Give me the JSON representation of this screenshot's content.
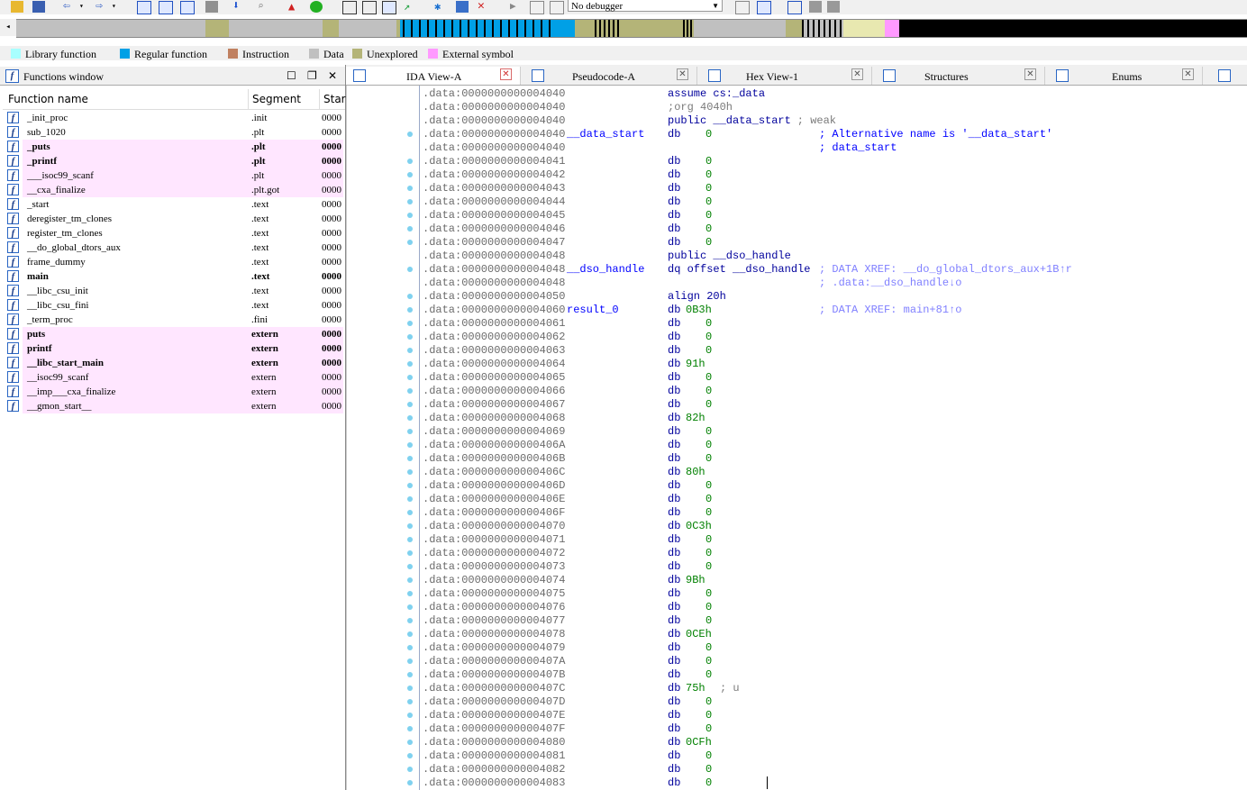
{
  "toolbar": {
    "debugger_label": "No debugger",
    "icons": [
      "open-icon",
      "save-icon",
      "back-icon",
      "forward-icon",
      "toggle-icon",
      "tools-icon",
      "down-arrow-icon",
      "search-icon",
      "warning-icon",
      "green-circle-icon",
      "code-icon",
      "data-icon",
      "string-icon",
      "arrow-icon",
      "breakpoint-icon",
      "camera-icon",
      "stop-icon",
      "play-icon",
      "pause-icon",
      "stop-square-icon",
      "attach-icon",
      "debug-icon"
    ]
  },
  "colors": {
    "library_function": "#a8ffff",
    "regular_function": "#00a0e6",
    "instruction": "#c08060",
    "data": "#c0c0c0",
    "unexplored": "#b4b478",
    "external_symbol": "#ff99ff",
    "pink_row": "#ffe6ff"
  },
  "legend": [
    "Library function",
    "Regular function",
    "Instruction",
    "Data",
    "Unexplored",
    "External symbol"
  ],
  "functions_window": {
    "title": "Functions window",
    "columns": [
      "Function name",
      "Segment",
      "Star"
    ],
    "rows": [
      {
        "name": "_init_proc",
        "segment": ".init",
        "start": "0000",
        "pink": false,
        "bold": false
      },
      {
        "name": "sub_1020",
        "segment": ".plt",
        "start": "0000",
        "pink": false,
        "bold": false
      },
      {
        "name": "_puts",
        "segment": ".plt",
        "start": "0000",
        "pink": true,
        "bold": true
      },
      {
        "name": "_printf",
        "segment": ".plt",
        "start": "0000",
        "pink": true,
        "bold": true
      },
      {
        "name": "___isoc99_scanf",
        "segment": ".plt",
        "start": "0000",
        "pink": true,
        "bold": false
      },
      {
        "name": "__cxa_finalize",
        "segment": ".plt.got",
        "start": "0000",
        "pink": true,
        "bold": false
      },
      {
        "name": "_start",
        "segment": ".text",
        "start": "0000",
        "pink": false,
        "bold": false
      },
      {
        "name": "deregister_tm_clones",
        "segment": ".text",
        "start": "0000",
        "pink": false,
        "bold": false
      },
      {
        "name": "register_tm_clones",
        "segment": ".text",
        "start": "0000",
        "pink": false,
        "bold": false
      },
      {
        "name": "__do_global_dtors_aux",
        "segment": ".text",
        "start": "0000",
        "pink": false,
        "bold": false
      },
      {
        "name": "frame_dummy",
        "segment": ".text",
        "start": "0000",
        "pink": false,
        "bold": false
      },
      {
        "name": "main",
        "segment": ".text",
        "start": "0000",
        "pink": false,
        "bold": true
      },
      {
        "name": "__libc_csu_init",
        "segment": ".text",
        "start": "0000",
        "pink": false,
        "bold": false
      },
      {
        "name": "__libc_csu_fini",
        "segment": ".text",
        "start": "0000",
        "pink": false,
        "bold": false
      },
      {
        "name": "_term_proc",
        "segment": ".fini",
        "start": "0000",
        "pink": false,
        "bold": false
      },
      {
        "name": "puts",
        "segment": "extern",
        "start": "0000",
        "pink": true,
        "bold": true
      },
      {
        "name": "printf",
        "segment": "extern",
        "start": "0000",
        "pink": true,
        "bold": true
      },
      {
        "name": "__libc_start_main",
        "segment": "extern",
        "start": "0000",
        "pink": true,
        "bold": true
      },
      {
        "name": "__isoc99_scanf",
        "segment": "extern",
        "start": "0000",
        "pink": true,
        "bold": false
      },
      {
        "name": "__imp___cxa_finalize",
        "segment": "extern",
        "start": "0000",
        "pink": true,
        "bold": false
      },
      {
        "name": "__gmon_start__",
        "segment": "extern",
        "start": "0000",
        "pink": true,
        "bold": false
      }
    ]
  },
  "tabs": [
    {
      "label": "IDA View-A",
      "active": true
    },
    {
      "label": "Pseudocode-A",
      "active": false
    },
    {
      "label": "Hex View-1",
      "active": false
    },
    {
      "label": "Structures",
      "active": false
    },
    {
      "label": "Enums",
      "active": false
    }
  ],
  "disasm": [
    {
      "addr": ".data:0000000000004040",
      "dot": false,
      "label": "",
      "mnem": "assume cs:_data",
      "operand": "",
      "comment": "",
      "xref": ""
    },
    {
      "addr": ".data:0000000000004040",
      "dot": false,
      "label": "",
      "mnem": "",
      "operand": "",
      "comment": ";org 4040h",
      "xref": ""
    },
    {
      "addr": ".data:0000000000004040",
      "dot": false,
      "label": "",
      "mnem": "public __data_start",
      "operand": "",
      "comment": "; weak",
      "xref": ""
    },
    {
      "addr": ".data:0000000000004040",
      "dot": true,
      "label": "__data_start",
      "mnem": "db",
      "operand": "0",
      "comment": "",
      "xref": "; Alternative name is '__data_start'"
    },
    {
      "addr": ".data:0000000000004040",
      "dot": false,
      "label": "",
      "mnem": "",
      "operand": "",
      "comment": "",
      "xref": "; data_start"
    },
    {
      "addr": ".data:0000000000004041",
      "dot": true,
      "label": "",
      "mnem": "db",
      "operand": "0",
      "comment": "",
      "xref": ""
    },
    {
      "addr": ".data:0000000000004042",
      "dot": true,
      "label": "",
      "mnem": "db",
      "operand": "0",
      "comment": "",
      "xref": ""
    },
    {
      "addr": ".data:0000000000004043",
      "dot": true,
      "label": "",
      "mnem": "db",
      "operand": "0",
      "comment": "",
      "xref": ""
    },
    {
      "addr": ".data:0000000000004044",
      "dot": true,
      "label": "",
      "mnem": "db",
      "operand": "0",
      "comment": "",
      "xref": ""
    },
    {
      "addr": ".data:0000000000004045",
      "dot": true,
      "label": "",
      "mnem": "db",
      "operand": "0",
      "comment": "",
      "xref": ""
    },
    {
      "addr": ".data:0000000000004046",
      "dot": true,
      "label": "",
      "mnem": "db",
      "operand": "0",
      "comment": "",
      "xref": ""
    },
    {
      "addr": ".data:0000000000004047",
      "dot": true,
      "label": "",
      "mnem": "db",
      "operand": "0",
      "comment": "",
      "xref": ""
    },
    {
      "addr": ".data:0000000000004048",
      "dot": false,
      "label": "",
      "mnem": "public __dso_handle",
      "operand": "",
      "comment": "",
      "xref": ""
    },
    {
      "addr": ".data:0000000000004048",
      "dot": true,
      "label": "__dso_handle",
      "mnem": "dq offset __dso_handle",
      "operand": "",
      "comment": "",
      "xref": "; DATA XREF: __do_global_dtors_aux+1B↑r"
    },
    {
      "addr": ".data:0000000000004048",
      "dot": false,
      "label": "",
      "mnem": "",
      "operand": "",
      "comment": "",
      "xref": "; .data:__dso_handle↓o"
    },
    {
      "addr": ".data:0000000000004050",
      "dot": true,
      "label": "",
      "mnem": "align 20h",
      "operand": "",
      "comment": "",
      "xref": ""
    },
    {
      "addr": ".data:0000000000004060",
      "dot": true,
      "label": "result_0",
      "mnem": "db",
      "operand": "0B3h",
      "comment": "",
      "xref": "; DATA XREF: main+81↑o"
    },
    {
      "addr": ".data:0000000000004061",
      "dot": true,
      "label": "",
      "mnem": "db",
      "operand": "0",
      "comment": "",
      "xref": ""
    },
    {
      "addr": ".data:0000000000004062",
      "dot": true,
      "label": "",
      "mnem": "db",
      "operand": "0",
      "comment": "",
      "xref": ""
    },
    {
      "addr": ".data:0000000000004063",
      "dot": true,
      "label": "",
      "mnem": "db",
      "operand": "0",
      "comment": "",
      "xref": ""
    },
    {
      "addr": ".data:0000000000004064",
      "dot": true,
      "label": "",
      "mnem": "db",
      "operand": "91h",
      "comment": "",
      "xref": ""
    },
    {
      "addr": ".data:0000000000004065",
      "dot": true,
      "label": "",
      "mnem": "db",
      "operand": "0",
      "comment": "",
      "xref": ""
    },
    {
      "addr": ".data:0000000000004066",
      "dot": true,
      "label": "",
      "mnem": "db",
      "operand": "0",
      "comment": "",
      "xref": ""
    },
    {
      "addr": ".data:0000000000004067",
      "dot": true,
      "label": "",
      "mnem": "db",
      "operand": "0",
      "comment": "",
      "xref": ""
    },
    {
      "addr": ".data:0000000000004068",
      "dot": true,
      "label": "",
      "mnem": "db",
      "operand": "82h",
      "comment": "",
      "xref": ""
    },
    {
      "addr": ".data:0000000000004069",
      "dot": true,
      "label": "",
      "mnem": "db",
      "operand": "0",
      "comment": "",
      "xref": ""
    },
    {
      "addr": ".data:000000000000406A",
      "dot": true,
      "label": "",
      "mnem": "db",
      "operand": "0",
      "comment": "",
      "xref": ""
    },
    {
      "addr": ".data:000000000000406B",
      "dot": true,
      "label": "",
      "mnem": "db",
      "operand": "0",
      "comment": "",
      "xref": ""
    },
    {
      "addr": ".data:000000000000406C",
      "dot": true,
      "label": "",
      "mnem": "db",
      "operand": "80h",
      "comment": "",
      "xref": ""
    },
    {
      "addr": ".data:000000000000406D",
      "dot": true,
      "label": "",
      "mnem": "db",
      "operand": "0",
      "comment": "",
      "xref": ""
    },
    {
      "addr": ".data:000000000000406E",
      "dot": true,
      "label": "",
      "mnem": "db",
      "operand": "0",
      "comment": "",
      "xref": ""
    },
    {
      "addr": ".data:000000000000406F",
      "dot": true,
      "label": "",
      "mnem": "db",
      "operand": "0",
      "comment": "",
      "xref": ""
    },
    {
      "addr": ".data:0000000000004070",
      "dot": true,
      "label": "",
      "mnem": "db",
      "operand": "0C3h",
      "comment": "",
      "xref": ""
    },
    {
      "addr": ".data:0000000000004071",
      "dot": true,
      "label": "",
      "mnem": "db",
      "operand": "0",
      "comment": "",
      "xref": ""
    },
    {
      "addr": ".data:0000000000004072",
      "dot": true,
      "label": "",
      "mnem": "db",
      "operand": "0",
      "comment": "",
      "xref": ""
    },
    {
      "addr": ".data:0000000000004073",
      "dot": true,
      "label": "",
      "mnem": "db",
      "operand": "0",
      "comment": "",
      "xref": ""
    },
    {
      "addr": ".data:0000000000004074",
      "dot": true,
      "label": "",
      "mnem": "db",
      "operand": "9Bh",
      "comment": "",
      "xref": ""
    },
    {
      "addr": ".data:0000000000004075",
      "dot": true,
      "label": "",
      "mnem": "db",
      "operand": "0",
      "comment": "",
      "xref": ""
    },
    {
      "addr": ".data:0000000000004076",
      "dot": true,
      "label": "",
      "mnem": "db",
      "operand": "0",
      "comment": "",
      "xref": ""
    },
    {
      "addr": ".data:0000000000004077",
      "dot": true,
      "label": "",
      "mnem": "db",
      "operand": "0",
      "comment": "",
      "xref": ""
    },
    {
      "addr": ".data:0000000000004078",
      "dot": true,
      "label": "",
      "mnem": "db",
      "operand": "0CEh",
      "comment": "",
      "xref": ""
    },
    {
      "addr": ".data:0000000000004079",
      "dot": true,
      "label": "",
      "mnem": "db",
      "operand": "0",
      "comment": "",
      "xref": ""
    },
    {
      "addr": ".data:000000000000407A",
      "dot": true,
      "label": "",
      "mnem": "db",
      "operand": "0",
      "comment": "",
      "xref": ""
    },
    {
      "addr": ".data:000000000000407B",
      "dot": true,
      "label": "",
      "mnem": "db",
      "operand": "0",
      "comment": "",
      "xref": ""
    },
    {
      "addr": ".data:000000000000407C",
      "dot": true,
      "label": "",
      "mnem": "db",
      "operand": "75h",
      "comment": "; u",
      "xref": ""
    },
    {
      "addr": ".data:000000000000407D",
      "dot": true,
      "label": "",
      "mnem": "db",
      "operand": "0",
      "comment": "",
      "xref": ""
    },
    {
      "addr": ".data:000000000000407E",
      "dot": true,
      "label": "",
      "mnem": "db",
      "operand": "0",
      "comment": "",
      "xref": ""
    },
    {
      "addr": ".data:000000000000407F",
      "dot": true,
      "label": "",
      "mnem": "db",
      "operand": "0",
      "comment": "",
      "xref": ""
    },
    {
      "addr": ".data:0000000000004080",
      "dot": true,
      "label": "",
      "mnem": "db",
      "operand": "0CFh",
      "comment": "",
      "xref": ""
    },
    {
      "addr": ".data:0000000000004081",
      "dot": true,
      "label": "",
      "mnem": "db",
      "operand": "0",
      "comment": "",
      "xref": ""
    },
    {
      "addr": ".data:0000000000004082",
      "dot": true,
      "label": "",
      "mnem": "db",
      "operand": "0",
      "comment": "",
      "xref": ""
    },
    {
      "addr": ".data:0000000000004083",
      "dot": true,
      "label": "",
      "mnem": "db",
      "operand": "0",
      "comment": "",
      "xref": ""
    }
  ]
}
